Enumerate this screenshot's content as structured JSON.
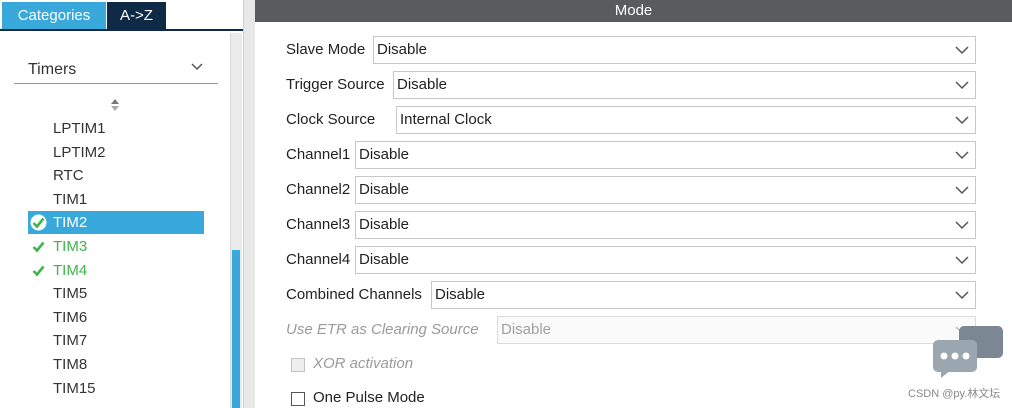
{
  "tabs": {
    "categories": "Categories",
    "az": "A->Z"
  },
  "category_select": {
    "value": "Timers",
    "icon": "chevron-down-icon"
  },
  "sort_icon": "sort-up-down-icon",
  "tree_items": [
    {
      "label": "LPTIM1",
      "state": "normal"
    },
    {
      "label": "LPTIM2",
      "state": "normal"
    },
    {
      "label": "RTC",
      "state": "normal"
    },
    {
      "label": "TIM1",
      "state": "normal"
    },
    {
      "label": "TIM2",
      "state": "selected-configured"
    },
    {
      "label": "TIM3",
      "state": "configured"
    },
    {
      "label": "TIM4",
      "state": "configured"
    },
    {
      "label": "TIM5",
      "state": "normal"
    },
    {
      "label": "TIM6",
      "state": "normal"
    },
    {
      "label": "TIM7",
      "state": "normal"
    },
    {
      "label": "TIM8",
      "state": "normal"
    },
    {
      "label": "TIM15",
      "state": "normal"
    }
  ],
  "mode": {
    "header": "Mode",
    "fields": [
      {
        "label": "Slave Mode",
        "value": "Disable",
        "enabled": true
      },
      {
        "label": "Trigger Source",
        "value": "Disable",
        "enabled": true
      },
      {
        "label": "Clock Source",
        "value": "Internal Clock",
        "enabled": true
      },
      {
        "label": "Channel1",
        "value": "Disable",
        "enabled": true
      },
      {
        "label": "Channel2",
        "value": "Disable",
        "enabled": true
      },
      {
        "label": "Channel3",
        "value": "Disable",
        "enabled": true
      },
      {
        "label": "Channel4",
        "value": "Disable",
        "enabled": true
      },
      {
        "label": "Combined Channels",
        "value": "Disable",
        "enabled": true
      },
      {
        "label": "Use ETR as Clearing Source",
        "value": "Disable",
        "enabled": false
      }
    ],
    "checkboxes": [
      {
        "label": "XOR activation",
        "checked": false,
        "enabled": false
      },
      {
        "label": "One Pulse Mode",
        "checked": false,
        "enabled": true
      }
    ]
  },
  "colors": {
    "accent": "#39a9dc",
    "tab_dark": "#0e2a47",
    "header_bg": "#585c5f",
    "configured_green": "#3db54a"
  },
  "watermark": {
    "text": "CSDN @py.林文坛",
    "icon": "chat-bubble-icon"
  }
}
